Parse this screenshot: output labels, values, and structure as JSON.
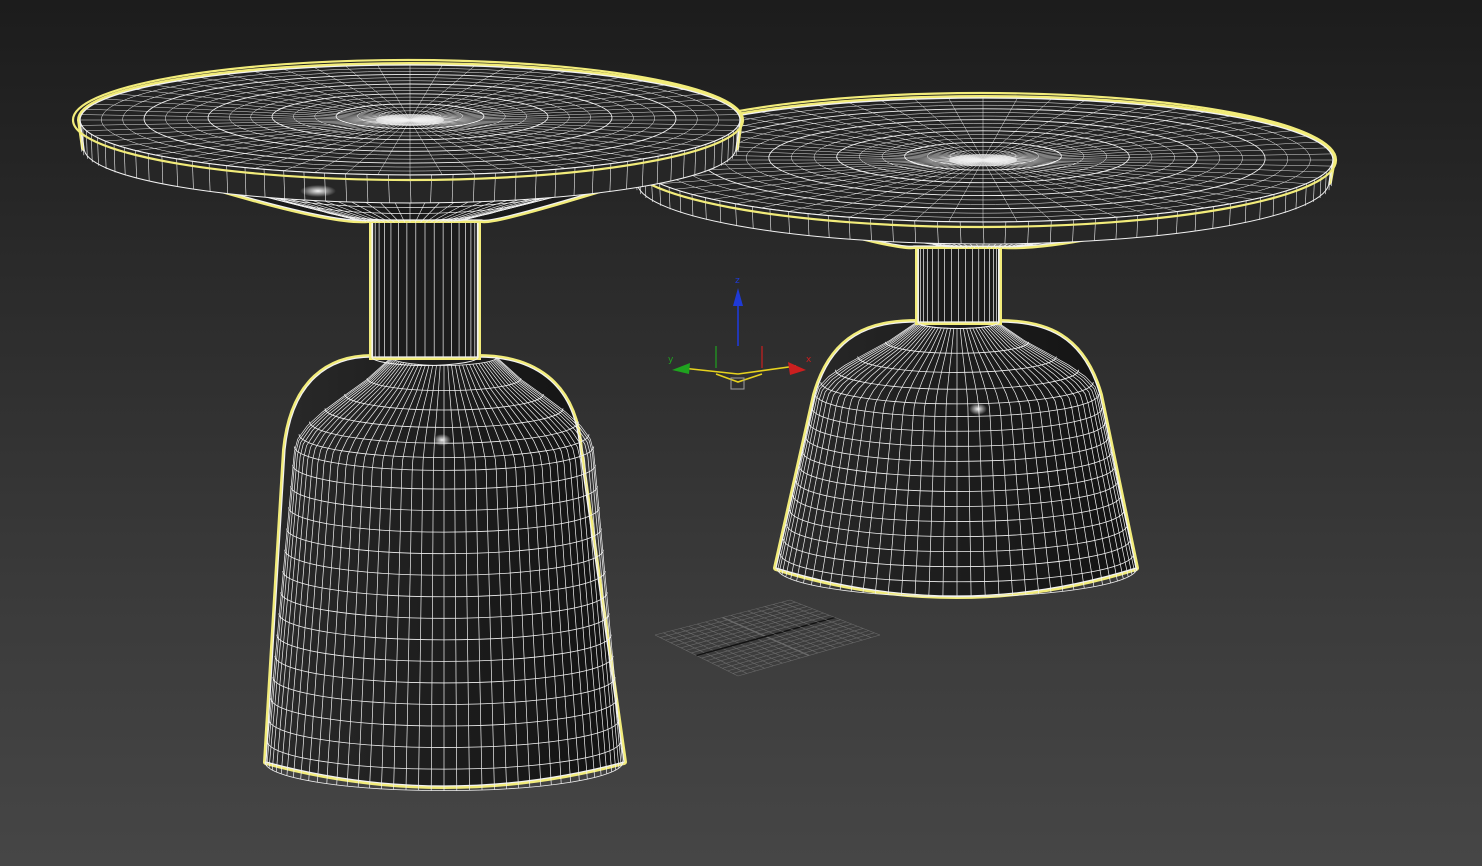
{
  "viewport": {
    "background_top": "#1c1c1c",
    "background_bottom": "#464646"
  },
  "selection_color": "#f2ec7a",
  "wire_color": "#f2f2f2",
  "object_fill": "#1a1a1a",
  "objects": [
    {
      "name": "side-table-left",
      "selected": true
    },
    {
      "name": "side-table-right",
      "selected": true
    }
  ],
  "transform_gizmo": {
    "axes": [
      {
        "label": "x",
        "color": "#cc1f1f"
      },
      {
        "label": "y",
        "color": "#1fa31f"
      },
      {
        "label": "z",
        "color": "#1f3ad6"
      }
    ],
    "plane_color": "#e6d21e"
  },
  "home_grid": {
    "color": "#6a6a6a"
  }
}
